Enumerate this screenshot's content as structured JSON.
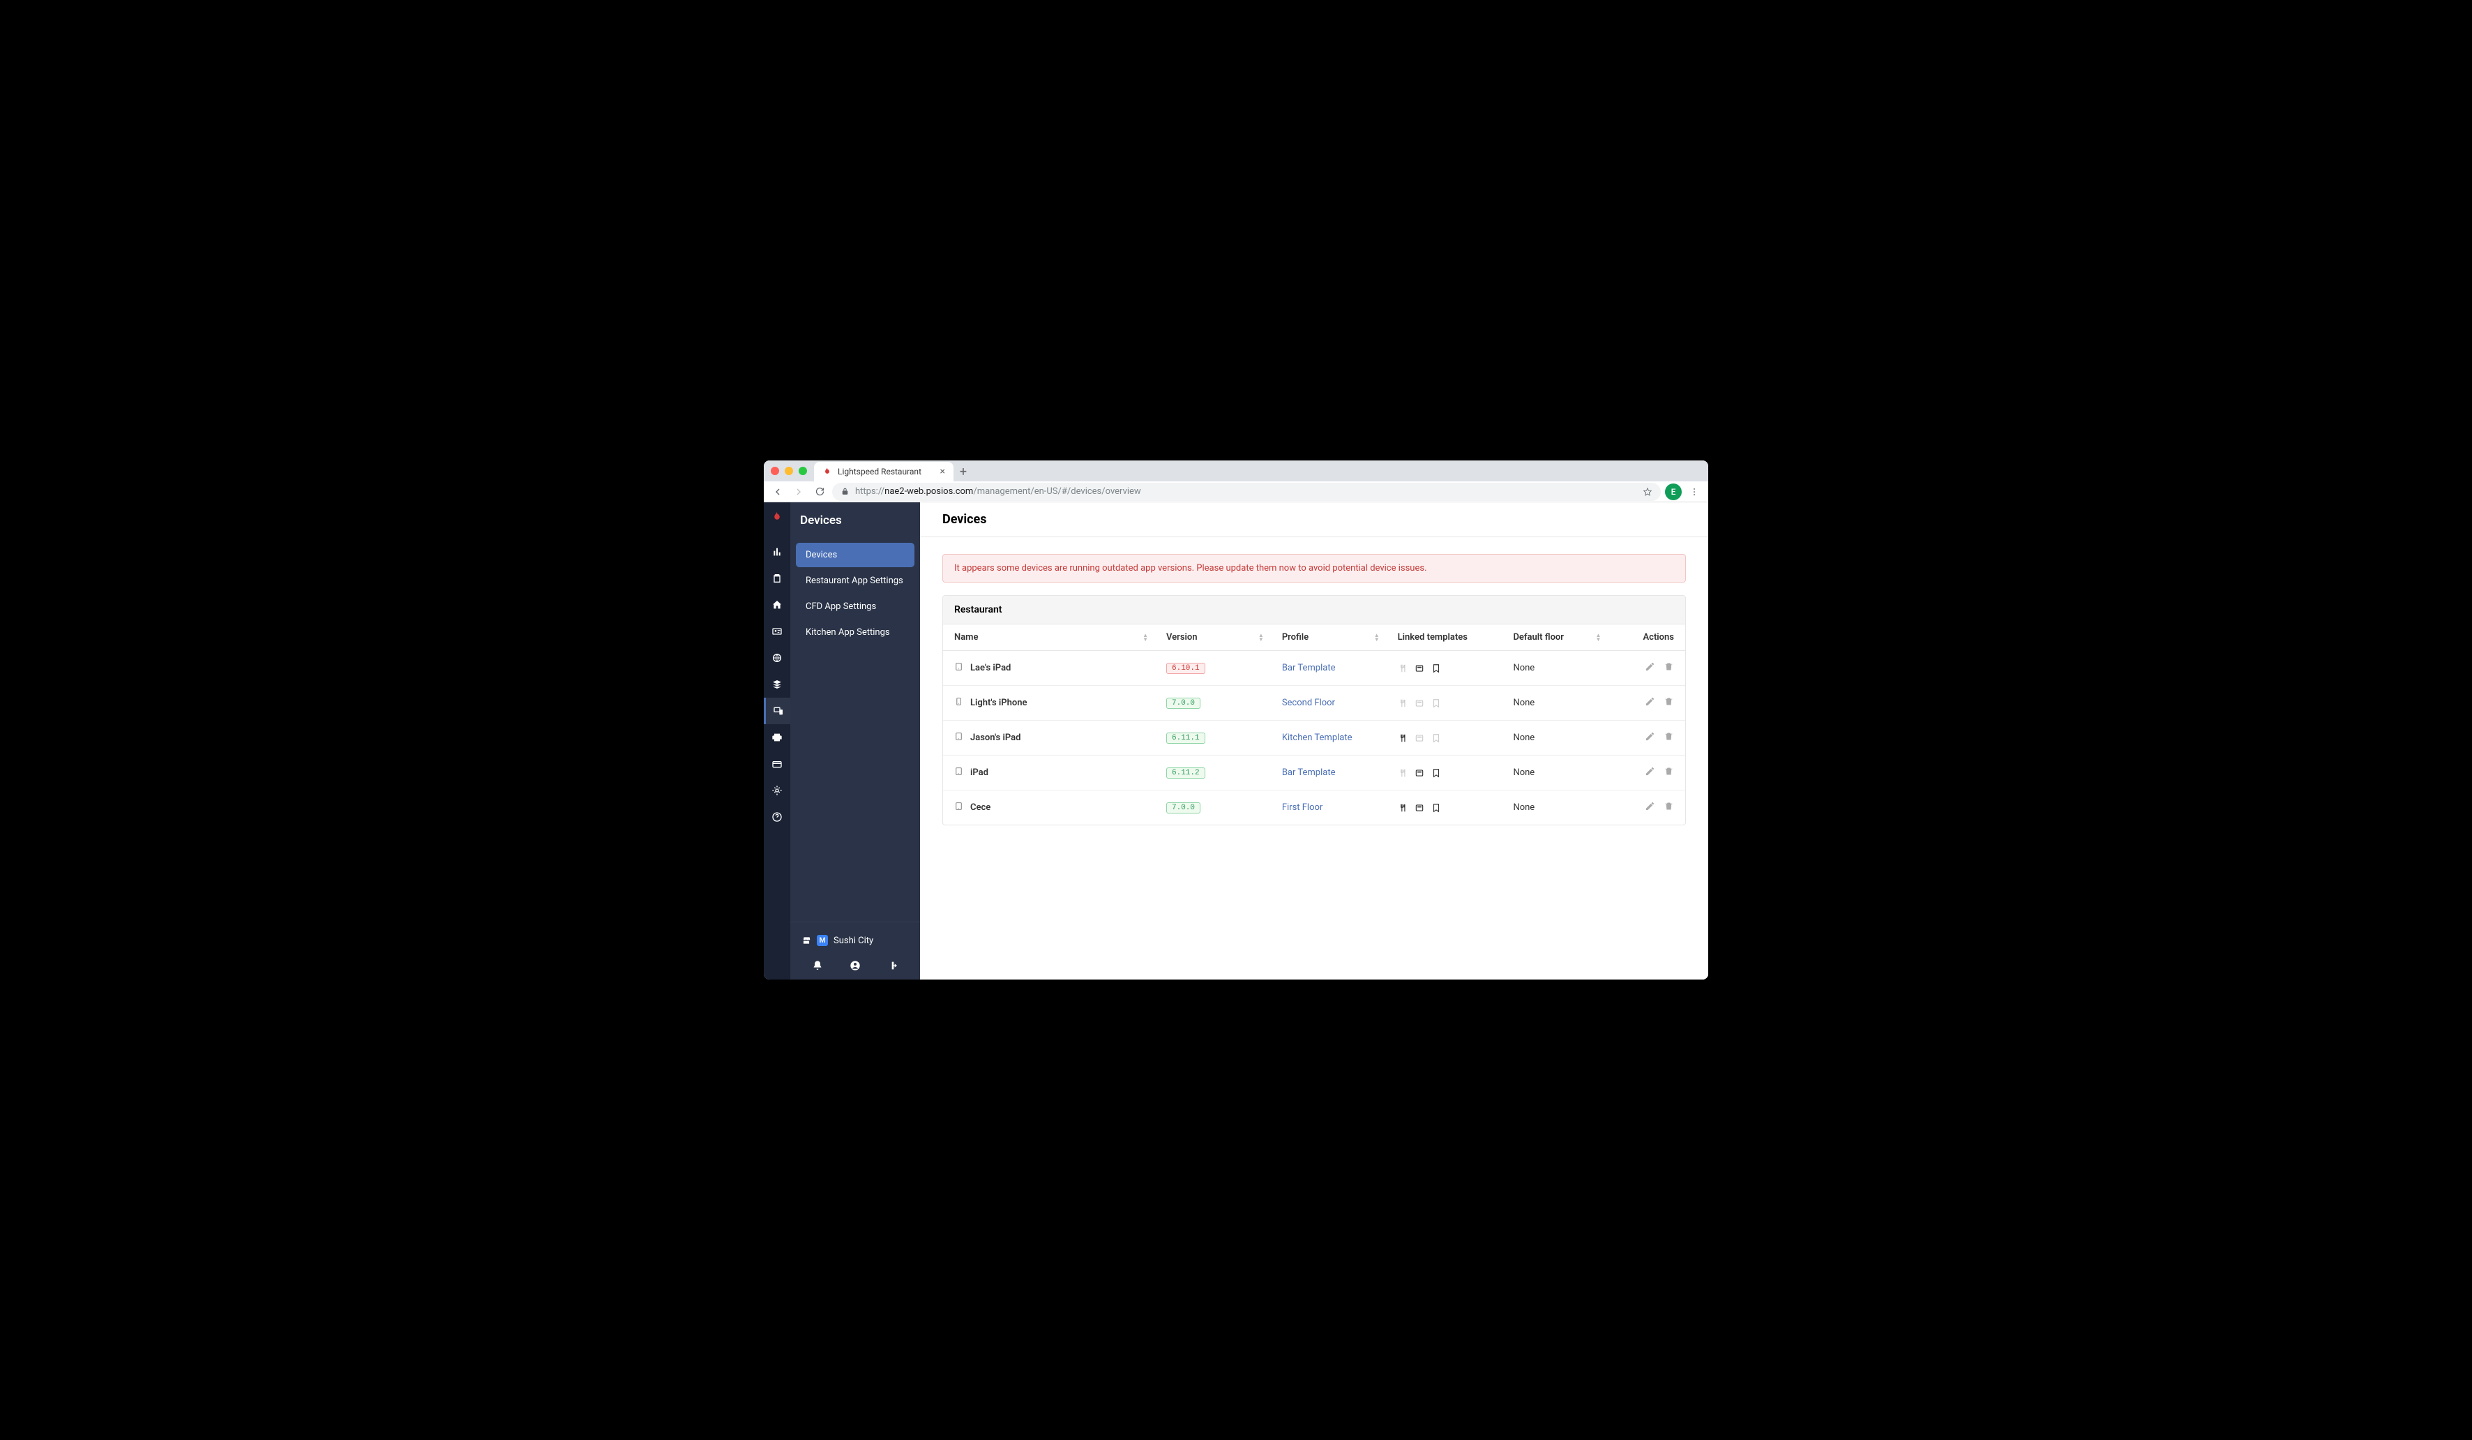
{
  "browser": {
    "tab_title": "Lightspeed Restaurant",
    "url_domain": "nae2-web.posios.com",
    "url_path": "/management/en-US/#/devices/overview",
    "url_prefix": "https://",
    "user_initial": "E"
  },
  "sidebar": {
    "title": "Devices",
    "items": [
      {
        "label": "Devices",
        "active": true
      },
      {
        "label": "Restaurant App Settings",
        "active": false
      },
      {
        "label": "CFD App Settings",
        "active": false
      },
      {
        "label": "Kitchen App Settings",
        "active": false
      }
    ],
    "company_badge": "M",
    "company_name": "Sushi City"
  },
  "page": {
    "title": "Devices",
    "alert": "It appears some devices are running outdated app versions. Please update them now to avoid potential device issues.",
    "table_title": "Restaurant",
    "columns": {
      "name": "Name",
      "version": "Version",
      "profile": "Profile",
      "templates": "Linked templates",
      "floor": "Default floor",
      "actions": "Actions"
    },
    "rows": [
      {
        "device_type": "tablet",
        "name": "Lae's iPad",
        "version": "6.10.1",
        "version_status": "outdated",
        "profile": "Bar Template",
        "tmpl": [
          false,
          true,
          true
        ],
        "floor": "None"
      },
      {
        "device_type": "phone",
        "name": "Light's iPhone",
        "version": "7.0.0",
        "version_status": "ok",
        "profile": "Second Floor",
        "tmpl": [
          false,
          false,
          false
        ],
        "floor": "None"
      },
      {
        "device_type": "tablet",
        "name": "Jason's iPad",
        "version": "6.11.1",
        "version_status": "ok",
        "profile": "Kitchen Template",
        "tmpl": [
          true,
          false,
          false
        ],
        "floor": "None"
      },
      {
        "device_type": "tablet",
        "name": "iPad",
        "version": "6.11.2",
        "version_status": "ok",
        "profile": "Bar Template",
        "tmpl": [
          false,
          true,
          true
        ],
        "floor": "None"
      },
      {
        "device_type": "tablet",
        "name": "Cece",
        "version": "7.0.0",
        "version_status": "ok",
        "profile": "First Floor",
        "tmpl": [
          true,
          true,
          true
        ],
        "floor": "None"
      }
    ]
  }
}
